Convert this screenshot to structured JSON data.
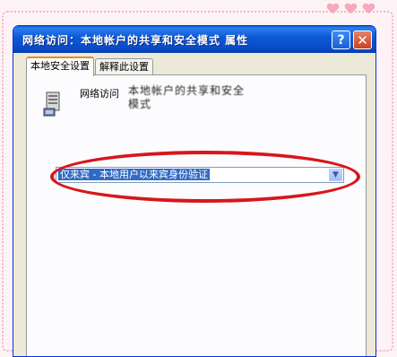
{
  "window": {
    "title": "网络访问：本地帐户的共享和安全模式 属性",
    "help_label": "?",
    "close_label": "✕"
  },
  "tabs": [
    {
      "label": "本地安全设置",
      "active": true
    },
    {
      "label": "解释此设置",
      "active": false
    }
  ],
  "setting": {
    "label": "网络访问",
    "description": "本地帐户的共享和安全模式",
    "icon": "network-policy-icon"
  },
  "dropdown": {
    "selected": "仅来宾 - 本地用户以来宾身份验证",
    "arrow": "▼"
  },
  "colors": {
    "titlebar": "#0a5fd8",
    "highlight": "#d7161c",
    "selection": "#316ac5"
  }
}
